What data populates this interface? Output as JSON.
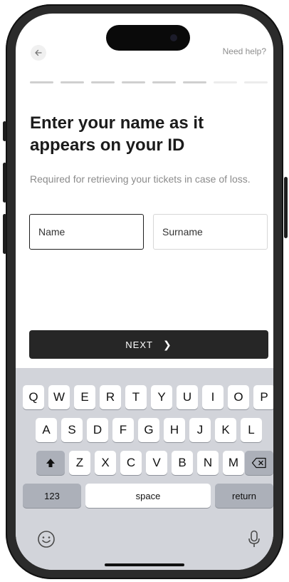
{
  "header": {
    "help_label": "Need help?"
  },
  "progress": {
    "total_steps": 8,
    "completed_steps": 6
  },
  "title": "Enter your name as it appears on your ID",
  "subtitle": "Required for retrieving your tickets in case of loss.",
  "fields": {
    "name_placeholder": "Name",
    "surname_placeholder": "Surname"
  },
  "next_button": {
    "label": "NEXT",
    "icon": "chevron-right-icon"
  },
  "keyboard": {
    "row1": [
      "Q",
      "W",
      "E",
      "R",
      "T",
      "Y",
      "U",
      "I",
      "O",
      "P"
    ],
    "row2": [
      "A",
      "S",
      "D",
      "F",
      "G",
      "H",
      "J",
      "K",
      "L"
    ],
    "row3": [
      "Z",
      "X",
      "C",
      "V",
      "B",
      "N",
      "M"
    ],
    "numbers_label": "123",
    "space_label": "space",
    "return_label": "return",
    "icons": [
      "shift-icon",
      "backspace-icon",
      "emoji-icon",
      "microphone-icon"
    ]
  },
  "colors": {
    "accent": "#262626",
    "keyboard_bg": "#d2d4da",
    "muted_text": "#8b8b8b"
  }
}
